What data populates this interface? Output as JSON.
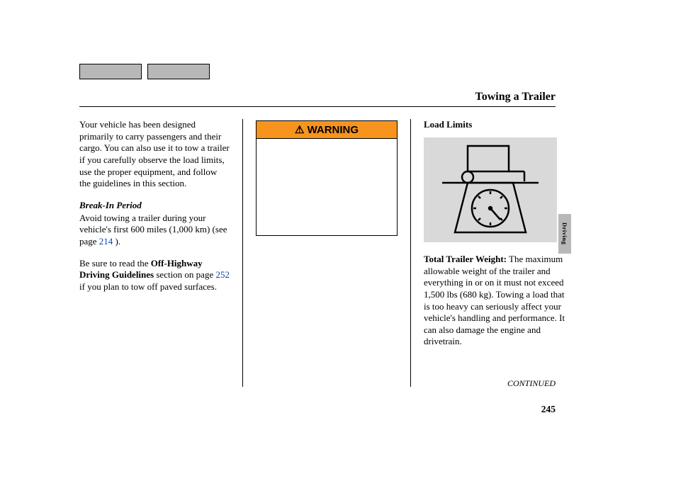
{
  "title": "Towing a Trailer",
  "col1": {
    "intro": "Your vehicle has been designed primarily to carry passengers and their cargo. You can also use it to tow a trailer if you carefully observe the load limits, use the proper equipment, and follow the guidelines in this section.",
    "breakin_head": "Break-In Period",
    "breakin_a": "Avoid towing a trailer during your vehicle's first 600 miles (1,000 km) (see page ",
    "breakin_link": "214",
    "breakin_b": " ).",
    "offhwy_a": "Be sure to read the ",
    "offhwy_bold": "Off-Highway Driving Guidelines",
    "offhwy_b": " section on page ",
    "offhwy_link": " 252",
    "offhwy_c": " if you plan to tow off paved surfaces."
  },
  "col2": {
    "warning_label": "WARNING"
  },
  "col3": {
    "load_limits": "Load Limits",
    "trailer_bold": "Total Trailer Weight:",
    "trailer_text": " The maximum allowable weight of the trailer and everything in or on it must not exceed 1,500 lbs (680 kg). Towing a load that is too heavy can seriously affect your vehicle's handling and performance. It can also damage the engine and drivetrain."
  },
  "continued": "CONTINUED",
  "page_number": "245",
  "side_tab": "Driving"
}
